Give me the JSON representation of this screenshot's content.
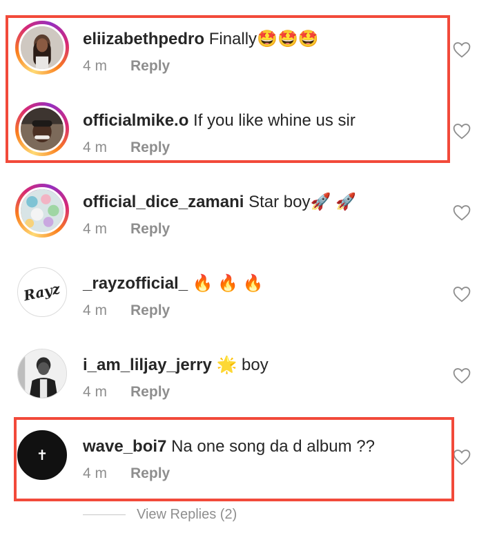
{
  "comments": [
    {
      "username": "eliizabethpedro",
      "text": "Finally🤩🤩🤩",
      "time": "4 m",
      "reply": "Reply"
    },
    {
      "username": "officialmike.o",
      "text": "If you like whine us sir",
      "time": "4 m",
      "reply": "Reply"
    },
    {
      "username": "official_dice_zamani",
      "text": "Star boy🚀 🚀",
      "time": "4 m",
      "reply": "Reply"
    },
    {
      "username": "_rayzofficial_",
      "text": "🔥 🔥 🔥",
      "time": "4 m",
      "reply": "Reply"
    },
    {
      "username": "i_am_liljay_jerry",
      "text": "🌟 boy",
      "time": "4 m",
      "reply": "Reply"
    },
    {
      "username": "wave_boi7",
      "text": "Na one song da d album ??",
      "time": "4 m",
      "reply": "Reply"
    }
  ],
  "avatars": {
    "rayz_logo_text": "Rayz",
    "wave_cross": "✝"
  },
  "view_replies": "View Replies (2)",
  "colors": {
    "highlight": "#f24a3a",
    "meta": "#8e8e8e",
    "text": "#262626"
  },
  "icons": [
    "heart-icon"
  ]
}
